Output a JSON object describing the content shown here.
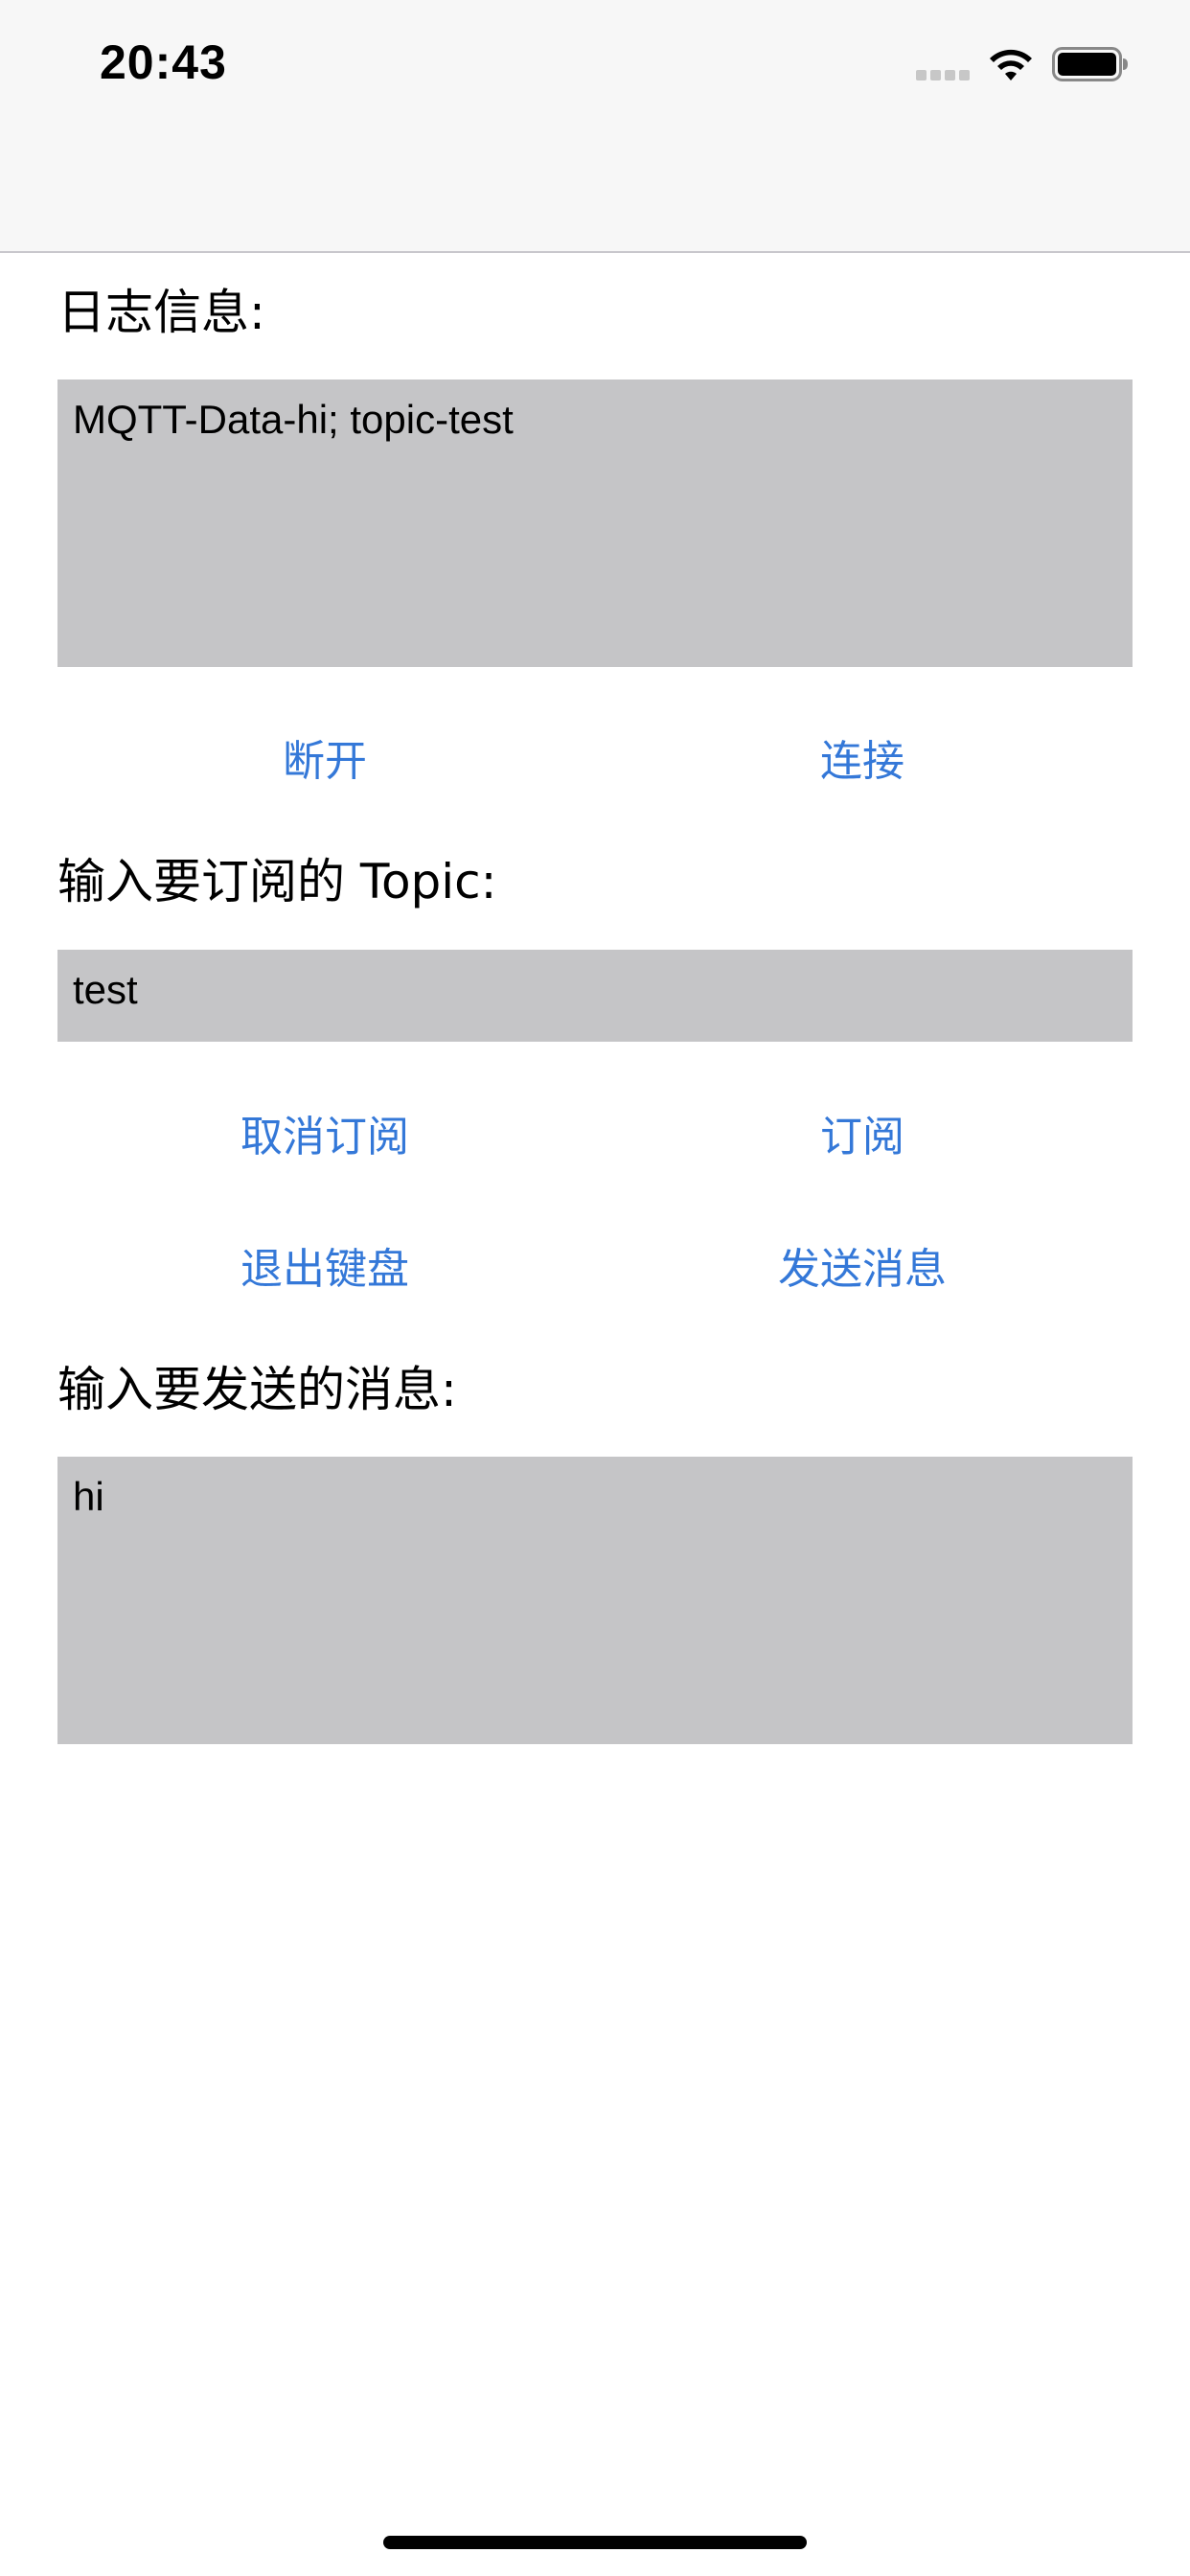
{
  "status_bar": {
    "time": "20:43",
    "icons": [
      "signal-dots-icon",
      "wifi-icon",
      "battery-icon"
    ]
  },
  "log_section": {
    "label": "日志信息:",
    "value": "MQTT-Data-hi; topic-test"
  },
  "connection_buttons": {
    "disconnect_label": "断开",
    "connect_label": "连接"
  },
  "topic_section": {
    "label": "输入要订阅的 Topic:",
    "value": "test"
  },
  "subscription_buttons": {
    "unsubscribe_label": "取消订阅",
    "subscribe_label": "订阅"
  },
  "action_buttons": {
    "dismiss_keyboard_label": "退出键盘",
    "send_message_label": "发送消息"
  },
  "message_section": {
    "label": "输入要发送的消息:",
    "value": "hi"
  },
  "colors": {
    "accent": "#3478d8",
    "field_background": "#c5c5c7",
    "nav_background": "#f7f7f7"
  }
}
